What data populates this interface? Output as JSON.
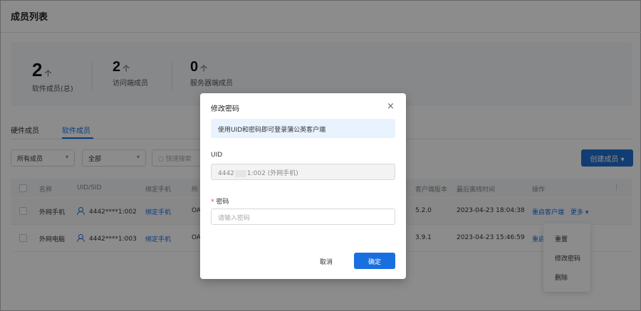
{
  "page": {
    "title": "成员列表"
  },
  "stats": [
    {
      "value": "2",
      "unit": "个",
      "label": "软件成员(总)"
    },
    {
      "value": "2",
      "unit": "个",
      "label": "访问端成员"
    },
    {
      "value": "0",
      "unit": "个",
      "label": "服务器端成员"
    }
  ],
  "tabs": [
    {
      "label": "硬件成员",
      "active": false
    },
    {
      "label": "软件成员",
      "active": true
    }
  ],
  "filters": {
    "member_type": "所有成员",
    "scope": "全部",
    "search_icon": "search-icon",
    "search_placeholder": "快速搜索",
    "chevron": "▾"
  },
  "create_button": {
    "label": "创建成员",
    "chevron": "▾"
  },
  "table": {
    "headers": {
      "name": "名称",
      "uid": "UID/SID",
      "phone": "绑定手机",
      "group": "所",
      "version": "客户端版本",
      "last_offline": "最后离线时间",
      "actions": "操作",
      "settings": "⋮"
    },
    "rows": [
      {
        "name": "外网手机",
        "uid": "4442****1:002",
        "phone": "绑定手机",
        "group": "OA",
        "version": "5.2.0",
        "last_offline": "2023-04-23 18:04:38",
        "restart": "重启客户端",
        "more": "更多 ▾"
      },
      {
        "name": "外网电脑",
        "uid": "4442****1:003",
        "phone": "绑定手机",
        "group": "OA",
        "version": "3.9.1",
        "last_offline": "2023-04-23 15:46:59",
        "restart": "重启"
      }
    ]
  },
  "more_menu": {
    "items": [
      "重置",
      "修改密码",
      "删除"
    ]
  },
  "modal": {
    "title": "修改密码",
    "close": "×",
    "info": "使用UID和密码即可登录蒲公英客户端",
    "uid_label": "UID",
    "uid_prefix": "4442",
    "uid_suffix": "1:002 (外网手机)",
    "password_required_mark": "*",
    "password_label": "密码",
    "password_placeholder": "请输入密码",
    "cancel_label": "取消",
    "ok_label": "确定"
  },
  "colors": {
    "accent": "#1a6fe0",
    "overlay": "rgba(0,0,0,0.45)",
    "info_bg": "#e9f3fd",
    "required": "#e5484d"
  }
}
